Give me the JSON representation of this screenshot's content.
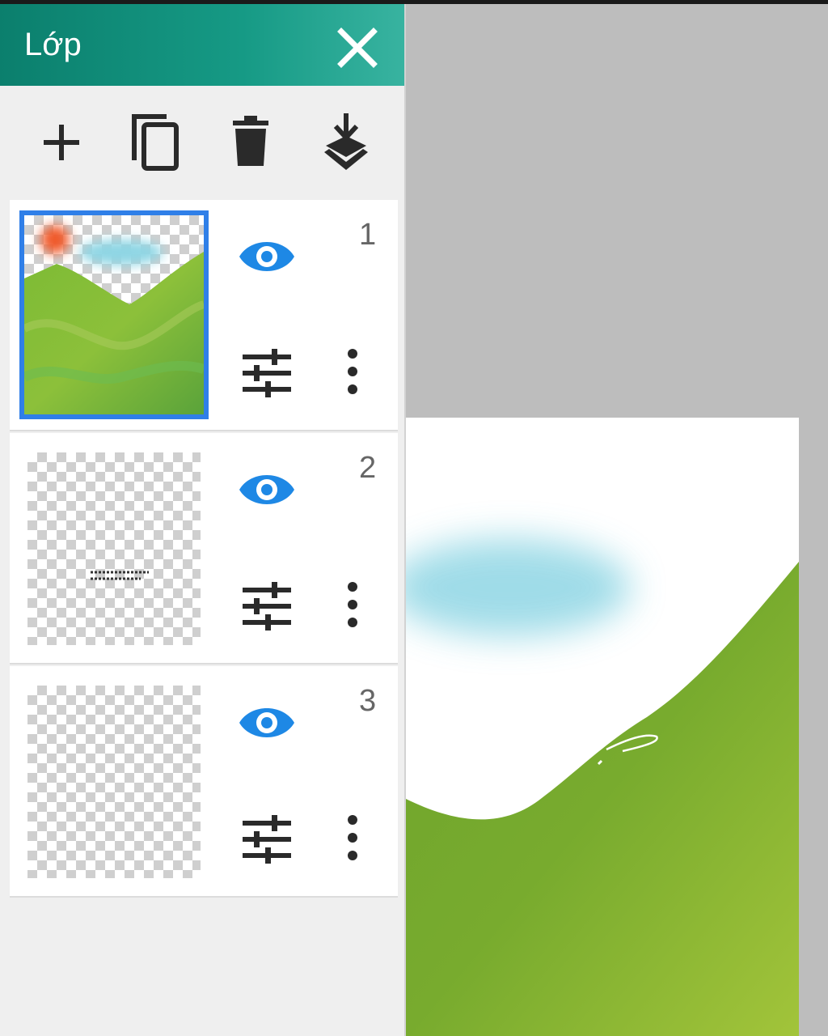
{
  "panel": {
    "title": "Lớp",
    "close_icon": "close-icon"
  },
  "toolbar": {
    "items": [
      {
        "name": "add-layer",
        "icon": "plus-icon"
      },
      {
        "name": "duplicate-layer",
        "icon": "copy-icon"
      },
      {
        "name": "delete-layer",
        "icon": "trash-icon"
      },
      {
        "name": "merge-down",
        "icon": "merge-down-icon"
      }
    ]
  },
  "layers": [
    {
      "number": "1",
      "selected": true,
      "visible": true
    },
    {
      "number": "2",
      "selected": false,
      "visible": true
    },
    {
      "number": "3",
      "selected": false,
      "visible": true
    }
  ],
  "colors": {
    "header": "#169a85",
    "accent": "#2f7fe8",
    "eye": "#1e88e5"
  }
}
